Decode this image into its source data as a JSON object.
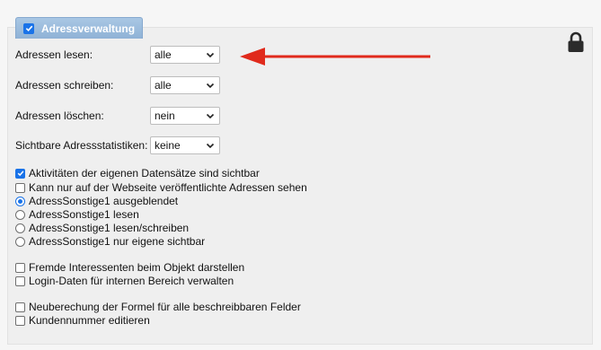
{
  "section": {
    "title": "Adressverwaltung",
    "enabled": true
  },
  "icons": {
    "lock": "lock-icon",
    "arrow": "arrow-left-icon"
  },
  "colors": {
    "accent": "#1a73e8",
    "arrow": "#e02a1c",
    "tab": "#9bbde0"
  },
  "settings": [
    {
      "label": "Adressen lesen:",
      "value": "alle"
    },
    {
      "label": "Adressen schreiben:",
      "value": "alle"
    },
    {
      "label": "Adressen löschen:",
      "value": "nein"
    },
    {
      "label": "Sichtbare Adressstatistiken:",
      "value": "keine"
    }
  ],
  "options": {
    "activities_visible": {
      "label": "Aktivitäten der eigenen Datensätze sind sichtbar",
      "checked": true
    },
    "website_only": {
      "label": "Kann nur auf der Webseite veröffentlichte Adressen sehen",
      "checked": false
    },
    "radio": [
      {
        "label": "AdressSonstige1 ausgeblendet",
        "checked": true
      },
      {
        "label": "AdressSonstige1 lesen",
        "checked": false
      },
      {
        "label": "AdressSonstige1 lesen/schreiben",
        "checked": false
      },
      {
        "label": "AdressSonstige1 nur eigene sichtbar",
        "checked": false
      }
    ],
    "foreign_prospects": {
      "label": "Fremde Interessenten beim Objekt darstellen",
      "checked": false
    },
    "login_data": {
      "label": "Login-Daten für internen Bereich verwalten",
      "checked": false
    },
    "recalc_formula": {
      "label": "Neuberechung der Formel für alle beschreibbaren Felder",
      "checked": false
    },
    "customer_number": {
      "label": "Kundennummer editieren",
      "checked": false
    }
  }
}
